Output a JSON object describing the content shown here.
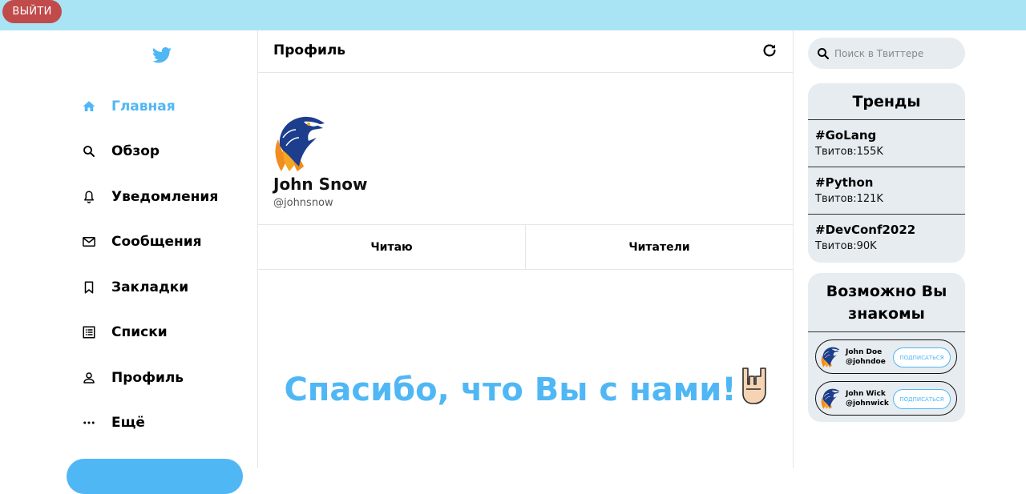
{
  "topbar": {
    "logout_label": "ВЫЙТИ"
  },
  "sidebar": {
    "items": [
      {
        "label": "Главная",
        "icon": "home-icon",
        "active": true
      },
      {
        "label": "Обзор",
        "icon": "search-icon"
      },
      {
        "label": "Уведомления",
        "icon": "bell-icon"
      },
      {
        "label": "Сообщения",
        "icon": "mail-icon"
      },
      {
        "label": "Закладки",
        "icon": "bookmark-icon"
      },
      {
        "label": "Списки",
        "icon": "list-icon"
      },
      {
        "label": "Профиль",
        "icon": "person-icon"
      },
      {
        "label": "Ещё",
        "icon": "more-icon"
      }
    ]
  },
  "main": {
    "title": "Профиль",
    "profile": {
      "name": "John Snow",
      "handle": "@johnsnow"
    },
    "tabs": [
      {
        "label": "Читаю"
      },
      {
        "label": "Читатели"
      }
    ],
    "thanks": "Спасибо, что Вы с нами!"
  },
  "search": {
    "placeholder": "Поиск в Твиттере"
  },
  "trends": {
    "title": "Тренды",
    "items": [
      {
        "tag": "#GoLang",
        "count": "Твитов:155K"
      },
      {
        "tag": "#Python",
        "count": "Твитов:121K"
      },
      {
        "tag": "#DevConf2022",
        "count": "Твитов:90K"
      }
    ]
  },
  "suggest": {
    "title": "Возможно Вы знакомы",
    "users": [
      {
        "name": "John Doe",
        "handle": "@johndoe",
        "button": "ПОДПИСАТЬСЯ"
      },
      {
        "name": "John Wick",
        "handle": "@johnwick",
        "button": "ПОДПИСАТЬСЯ"
      }
    ]
  },
  "colors": {
    "accent": "#50b7f5",
    "topbar": "#a9e4f5",
    "logout": "#c14a4a",
    "panel": "#e6ecf0"
  }
}
